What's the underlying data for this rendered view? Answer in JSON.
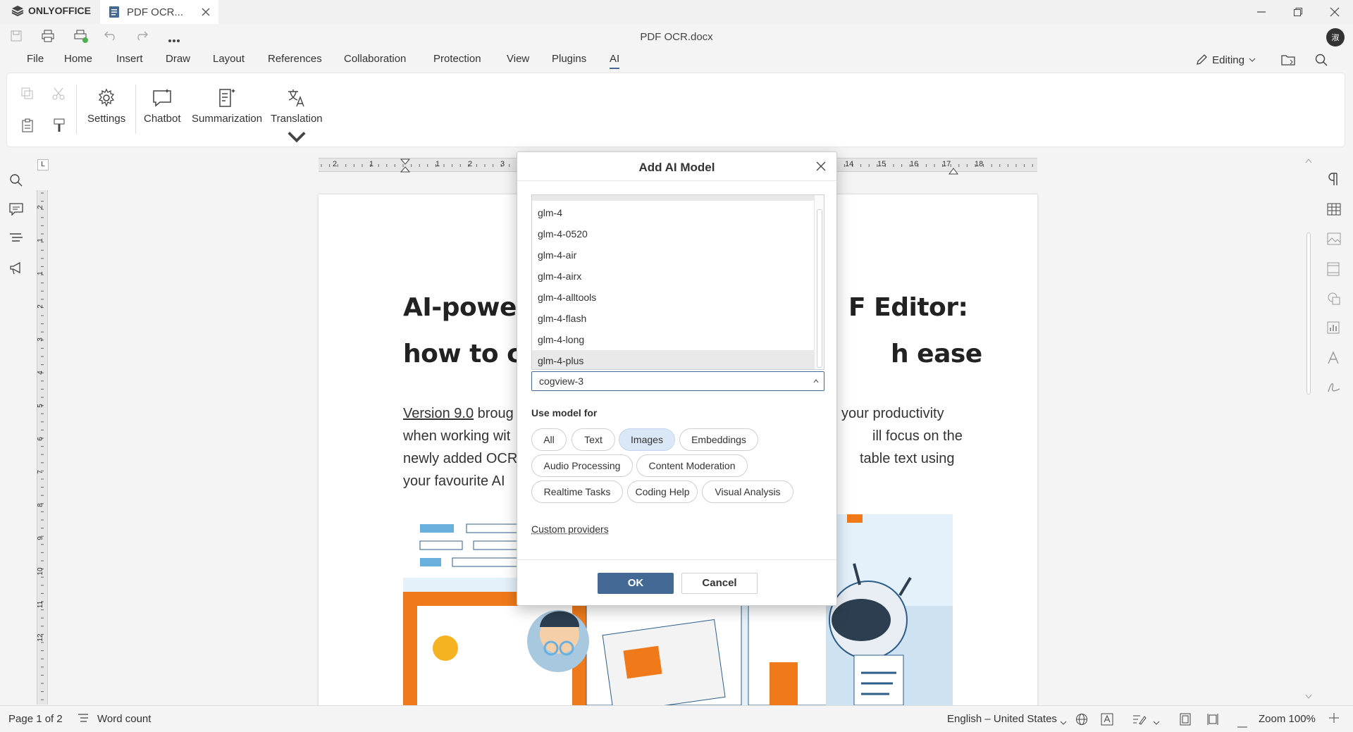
{
  "app": {
    "name": "ONLYOFFICE",
    "tab_title": "PDF OCR...",
    "doc_title": "PDF OCR.docx",
    "avatar": "淑"
  },
  "menu": [
    "File",
    "Home",
    "Insert",
    "Draw",
    "Layout",
    "References",
    "Collaboration",
    "Protection",
    "View",
    "Plugins",
    "AI"
  ],
  "active_menu": "AI",
  "editing_mode": "Editing",
  "ribbon": {
    "settings": "Settings",
    "chatbot": "Chatbot",
    "summarization": "Summarization",
    "translation": "Translation"
  },
  "ruler": {
    "h_labels": [
      "2",
      "1",
      "1",
      "2",
      "3",
      "14",
      "15",
      "16",
      "17",
      "18"
    ],
    "v_labels": [
      "2",
      "1",
      "1",
      "2",
      "3",
      "4",
      "5",
      "6",
      "7",
      "8",
      "9",
      "10",
      "11",
      "12"
    ]
  },
  "document": {
    "heading_1": "AI-powere",
    "heading_1_right": "F Editor:",
    "heading_2": "how to co",
    "heading_2_right": "h ease",
    "para_left": [
      "broug",
      "when working wit",
      "newly added OCR",
      "your favourite AI"
    ],
    "para_link": "Version 9.0",
    "para_right": [
      "your productivity",
      "ill focus on the",
      "table text using"
    ]
  },
  "dialog": {
    "title": "Add AI Model",
    "models": [
      "glm-4",
      "glm-4-0520",
      "glm-4-air",
      "glm-4-airx",
      "glm-4-alltools",
      "glm-4-flash",
      "glm-4-long",
      "glm-4-plus"
    ],
    "highlighted_model": "glm-4-plus",
    "selected_value": "cogview-3",
    "use_for_label": "Use model for",
    "chips": [
      {
        "label": "All",
        "on": false
      },
      {
        "label": "Text",
        "on": false
      },
      {
        "label": "Images",
        "on": true
      },
      {
        "label": "Embeddings",
        "on": false
      },
      {
        "label": "Audio Processing",
        "on": false
      },
      {
        "label": "Content Moderation",
        "on": false
      },
      {
        "label": "Realtime Tasks",
        "on": false
      },
      {
        "label": "Coding Help",
        "on": false
      },
      {
        "label": "Visual Analysis",
        "on": false
      }
    ],
    "custom_providers": "Custom providers",
    "ok": "OK",
    "cancel": "Cancel"
  },
  "status": {
    "page": "Page 1 of 2",
    "word_count": "Word count",
    "language": "English – United States",
    "zoom": "Zoom 100%"
  },
  "colors": {
    "accent": "#446995",
    "chip_on": "#dae7f6",
    "illustration_orange": "#f07a1a",
    "illustration_blue": "#e4f1fb"
  }
}
